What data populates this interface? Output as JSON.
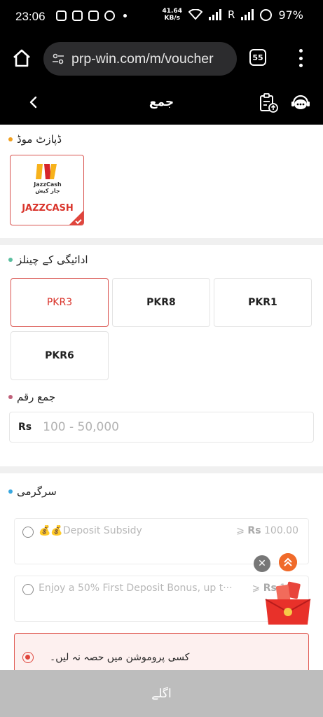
{
  "status_bar": {
    "time": "23:06",
    "net_speed_value": "41.64",
    "net_speed_unit": "KB/s",
    "roaming": "R",
    "battery": "97%"
  },
  "browser": {
    "url": "prp-win.com/m/voucher",
    "tab_count": "55"
  },
  "header": {
    "title": "جمع"
  },
  "deposit_mode": {
    "title": "ڈپازٹ موڈ",
    "dot_color": "#f0a020",
    "selected": {
      "logo_text_en": "JazzCash",
      "logo_text_ur": "جاز کیش",
      "label": "JAZZCASH"
    }
  },
  "channels": {
    "title": "ادائیگی کے چینلز",
    "dot_color": "#5bbfa0",
    "items": [
      {
        "label": "PKR3",
        "selected": true
      },
      {
        "label": "PKR8",
        "selected": false
      },
      {
        "label": "PKR1",
        "selected": false
      },
      {
        "label": "PKR6",
        "selected": false
      }
    ]
  },
  "amount": {
    "title": "جمع رقم",
    "dot_color": "#c0607a",
    "currency": "Rs",
    "placeholder": "100 - 50,000"
  },
  "activity": {
    "title": "سرگرمی",
    "dot_color": "#3aa8e0",
    "promos": [
      {
        "emoji": "💰💰",
        "name": "Deposit Subsidy",
        "min_prefix": "⩾",
        "min_currency": "Rs",
        "min_value": "100.00"
      },
      {
        "emoji": "",
        "name": "Enjoy a 50% First Deposit Bonus, up t···",
        "min_prefix": "⩾",
        "min_currency": "Rs",
        "min_value": "100"
      }
    ],
    "no_promo_label": "کسی پروموشن میں حصہ نہ لیں۔"
  },
  "footer": {
    "next_label": "اگلے"
  }
}
